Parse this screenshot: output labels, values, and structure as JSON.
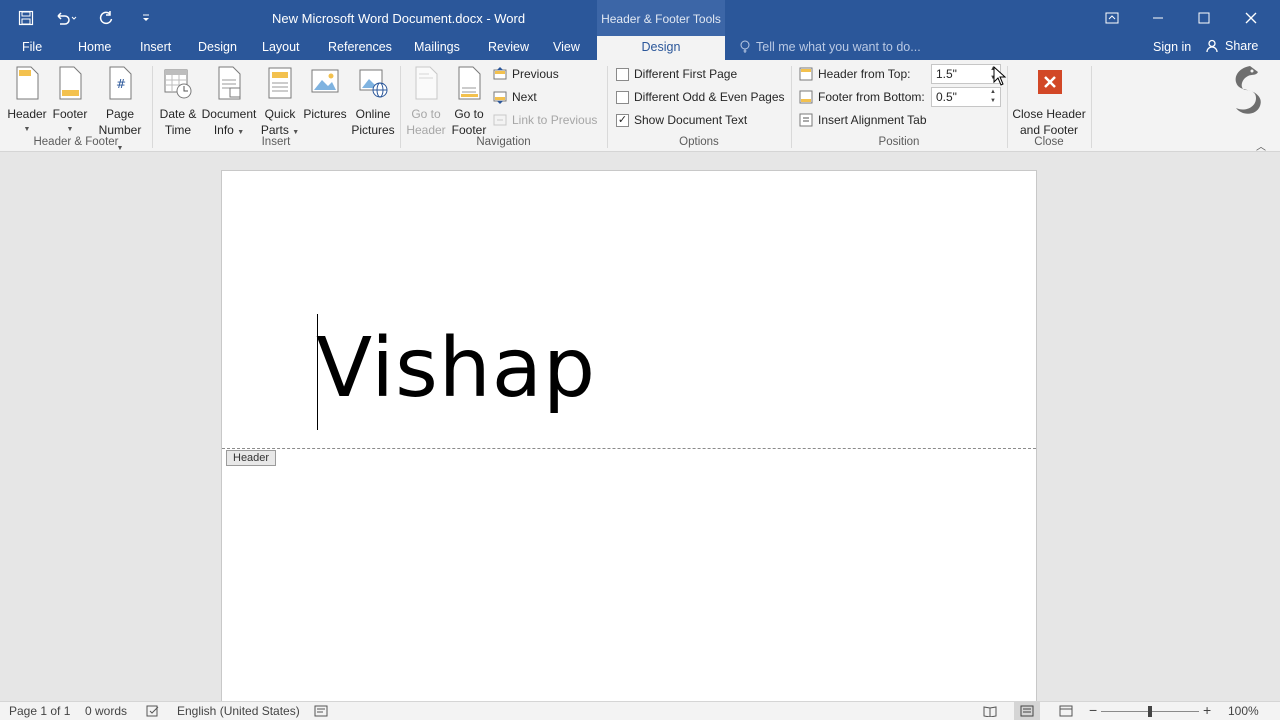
{
  "titlebar": {
    "title": "New Microsoft Word Document.docx - Word",
    "contextual_group": "Header & Footer Tools"
  },
  "tabs": [
    "File",
    "Home",
    "Insert",
    "Design",
    "Layout",
    "References",
    "Mailings",
    "Review",
    "View"
  ],
  "active_tab": "Design",
  "tellme_placeholder": "Tell me what you want to do...",
  "signin": "Sign in",
  "share": "Share",
  "ribbon": {
    "header_footer": {
      "label": "Header & Footer",
      "header": "Header",
      "footer": "Footer",
      "page_number_1": "Page",
      "page_number_2": "Number"
    },
    "insert": {
      "label": "Insert",
      "date_time_1": "Date &",
      "date_time_2": "Time",
      "doc_info_1": "Document",
      "doc_info_2": "Info",
      "quick_parts_1": "Quick",
      "quick_parts_2": "Parts",
      "pictures": "Pictures",
      "online_pictures_1": "Online",
      "online_pictures_2": "Pictures"
    },
    "navigation": {
      "label": "Navigation",
      "go_to_header_1": "Go to",
      "go_to_header_2": "Header",
      "go_to_footer_1": "Go to",
      "go_to_footer_2": "Footer",
      "previous": "Previous",
      "next": "Next",
      "link_to_previous": "Link to Previous"
    },
    "options": {
      "label": "Options",
      "different_first_page": "Different First Page",
      "different_odd_even": "Different Odd & Even Pages",
      "show_document_text": "Show Document Text",
      "different_first_page_checked": false,
      "different_odd_even_checked": false,
      "show_document_text_checked": true
    },
    "position": {
      "label": "Position",
      "header_from_top": "Header from Top:",
      "header_from_top_value": "1.5\"",
      "footer_from_bottom": "Footer from Bottom:",
      "footer_from_bottom_value": "0.5\"",
      "insert_alignment_tab": "Insert Alignment Tab"
    },
    "close": {
      "label": "Close",
      "close_hf_1": "Close Header",
      "close_hf_2": "and Footer"
    }
  },
  "document": {
    "header_text": "Vishap",
    "header_tag": "Header"
  },
  "statusbar": {
    "page": "Page 1 of 1",
    "words": "0 words",
    "language": "English (United States)",
    "zoom": "100%"
  },
  "colors": {
    "brand": "#2b579a",
    "ribbon_bg": "#f3f3f3",
    "close_red": "#d24726"
  }
}
